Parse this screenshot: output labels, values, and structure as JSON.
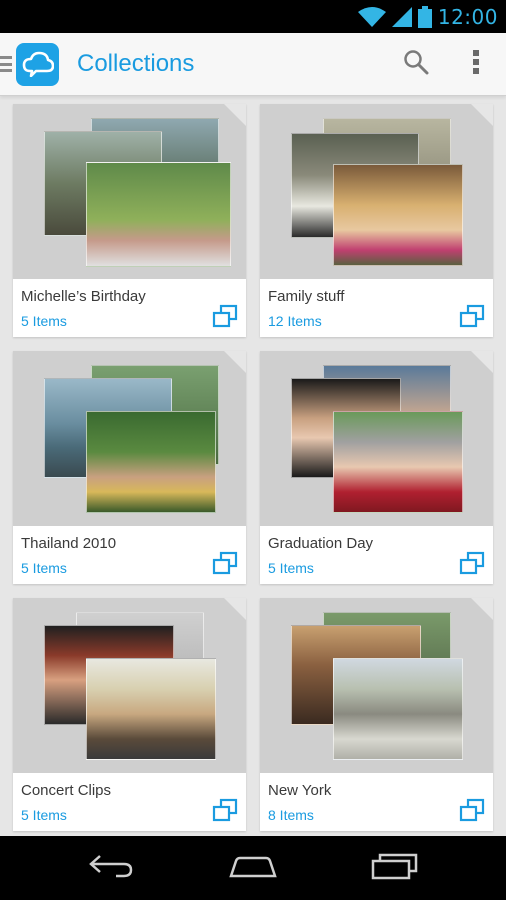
{
  "status_bar": {
    "time": "12:00",
    "icons": [
      "wifi-icon",
      "signal-icon",
      "battery-icon"
    ]
  },
  "action_bar": {
    "title": "Collections",
    "icons": [
      "menu-icon",
      "cloud-logo-icon",
      "search-icon",
      "overflow-menu-icon"
    ]
  },
  "collections": [
    {
      "title": "Michelle’s Birthday",
      "count": "5 Items"
    },
    {
      "title": "Family stuff",
      "count": "12 Items"
    },
    {
      "title": "Thailand 2010",
      "count": "5 Items"
    },
    {
      "title": "Graduation Day",
      "count": "5 Items"
    },
    {
      "title": "Concert Clips",
      "count": "5 Items"
    },
    {
      "title": "New York",
      "count": "8 Items"
    }
  ],
  "nav_bar": {
    "icons": [
      "back-icon",
      "home-icon",
      "recent-apps-icon"
    ]
  },
  "colors": {
    "accent": "#1a9be0",
    "status_time": "#33b5e5",
    "background": "#e6e6e6"
  }
}
